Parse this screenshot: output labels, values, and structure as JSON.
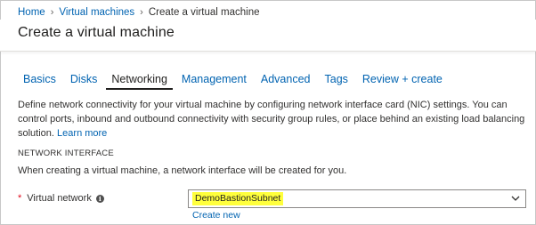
{
  "breadcrumb": {
    "items": [
      "Home",
      "Virtual machines"
    ],
    "current": "Create a virtual machine"
  },
  "page": {
    "title": "Create a virtual machine"
  },
  "tabs": [
    {
      "label": "Basics",
      "active": false
    },
    {
      "label": "Disks",
      "active": false
    },
    {
      "label": "Networking",
      "active": true
    },
    {
      "label": "Management",
      "active": false
    },
    {
      "label": "Advanced",
      "active": false
    },
    {
      "label": "Tags",
      "active": false
    },
    {
      "label": "Review + create",
      "active": false
    }
  ],
  "description": {
    "text": "Define network connectivity for your virtual machine by configuring network interface card (NIC) settings. You can control ports, inbound and outbound connectivity with security group rules, or place behind an existing load balancing solution.",
    "link": "Learn more"
  },
  "section": {
    "heading": "NETWORK INTERFACE",
    "text": "When creating a virtual machine, a network interface will be created for you."
  },
  "virtual_network": {
    "required_mark": "*",
    "label": "Virtual network",
    "value": "DemoBastionSubnet",
    "create_new": "Create new"
  },
  "colors": {
    "link": "#0063b1",
    "highlight": "#ffff3c",
    "required": "#e00b1c"
  },
  "icons": {
    "info": "info-icon",
    "chevron": "chevron-down-icon"
  }
}
